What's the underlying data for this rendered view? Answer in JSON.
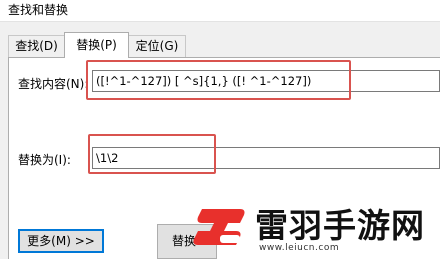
{
  "window": {
    "title": "查找和替换"
  },
  "tabs": [
    {
      "label": "查找(D)"
    },
    {
      "label": "替换(P)"
    },
    {
      "label": "定位(G)"
    }
  ],
  "find": {
    "label": "查找内容(N):",
    "value": "([!^1-^127]) [ ^s]{1,} ([! ^1-^127])"
  },
  "replace": {
    "label": "替换为(I):",
    "value": "\\1\\2"
  },
  "buttons": {
    "more": "更多(M) >>",
    "replace": "替换"
  },
  "watermark": {
    "brand": "雷羽手游网",
    "url": "www.leiucn.com"
  },
  "colors": {
    "highlight": "#d9534f",
    "logo_red": "#e8302c",
    "focus_blue": "#0078d7"
  }
}
